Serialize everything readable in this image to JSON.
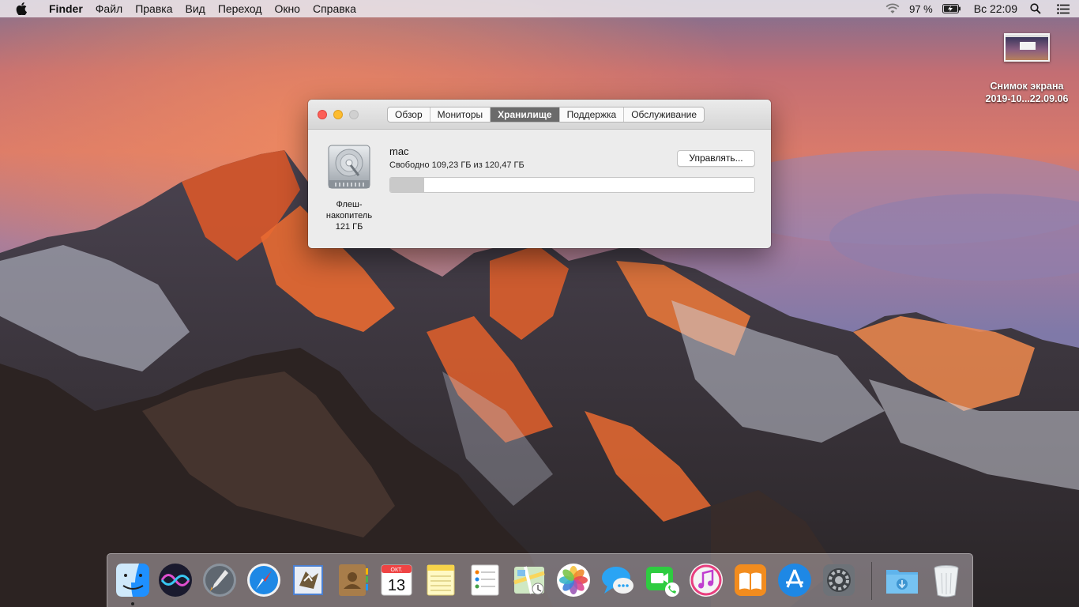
{
  "menubar": {
    "app_name": "Finder",
    "items": [
      "Файл",
      "Правка",
      "Вид",
      "Переход",
      "Окно",
      "Справка"
    ],
    "battery_percent": "97 %",
    "clock": "Вс 22:09"
  },
  "desktop": {
    "file_label_line1": "Снимок экрана",
    "file_label_line2": "2019-10...22.09.06"
  },
  "window": {
    "tabs": [
      {
        "label": "Обзор",
        "active": false
      },
      {
        "label": "Мониторы",
        "active": false
      },
      {
        "label": "Хранилище",
        "active": true
      },
      {
        "label": "Поддержка",
        "active": false
      },
      {
        "label": "Обслуживание",
        "active": false
      }
    ],
    "drive": {
      "label_line1": "Флеш-",
      "label_line2": "накопитель",
      "label_line3": "121 ГБ"
    },
    "volume": {
      "name": "mac",
      "free_text": "Свободно 109,23 ГБ из 120,47 ГБ",
      "used_fraction": 0.093
    },
    "manage_label": "Управлять..."
  },
  "dock": {
    "apps": [
      "Finder",
      "Siri",
      "Launchpad",
      "Safari",
      "Mail",
      "Контакты",
      "Календарь",
      "Заметки",
      "Напоминания",
      "Карты",
      "Фото",
      "Сообщения",
      "FaceTime",
      "iTunes",
      "iBooks",
      "App Store",
      "Системные настройки",
      "Загрузки",
      "Корзина"
    ],
    "calendar_month": "ОКТ.",
    "calendar_day": "13"
  },
  "colors": {
    "close": "#fc5f57",
    "minimize": "#fdbc2e",
    "active_tab": "#6b6b6b"
  }
}
